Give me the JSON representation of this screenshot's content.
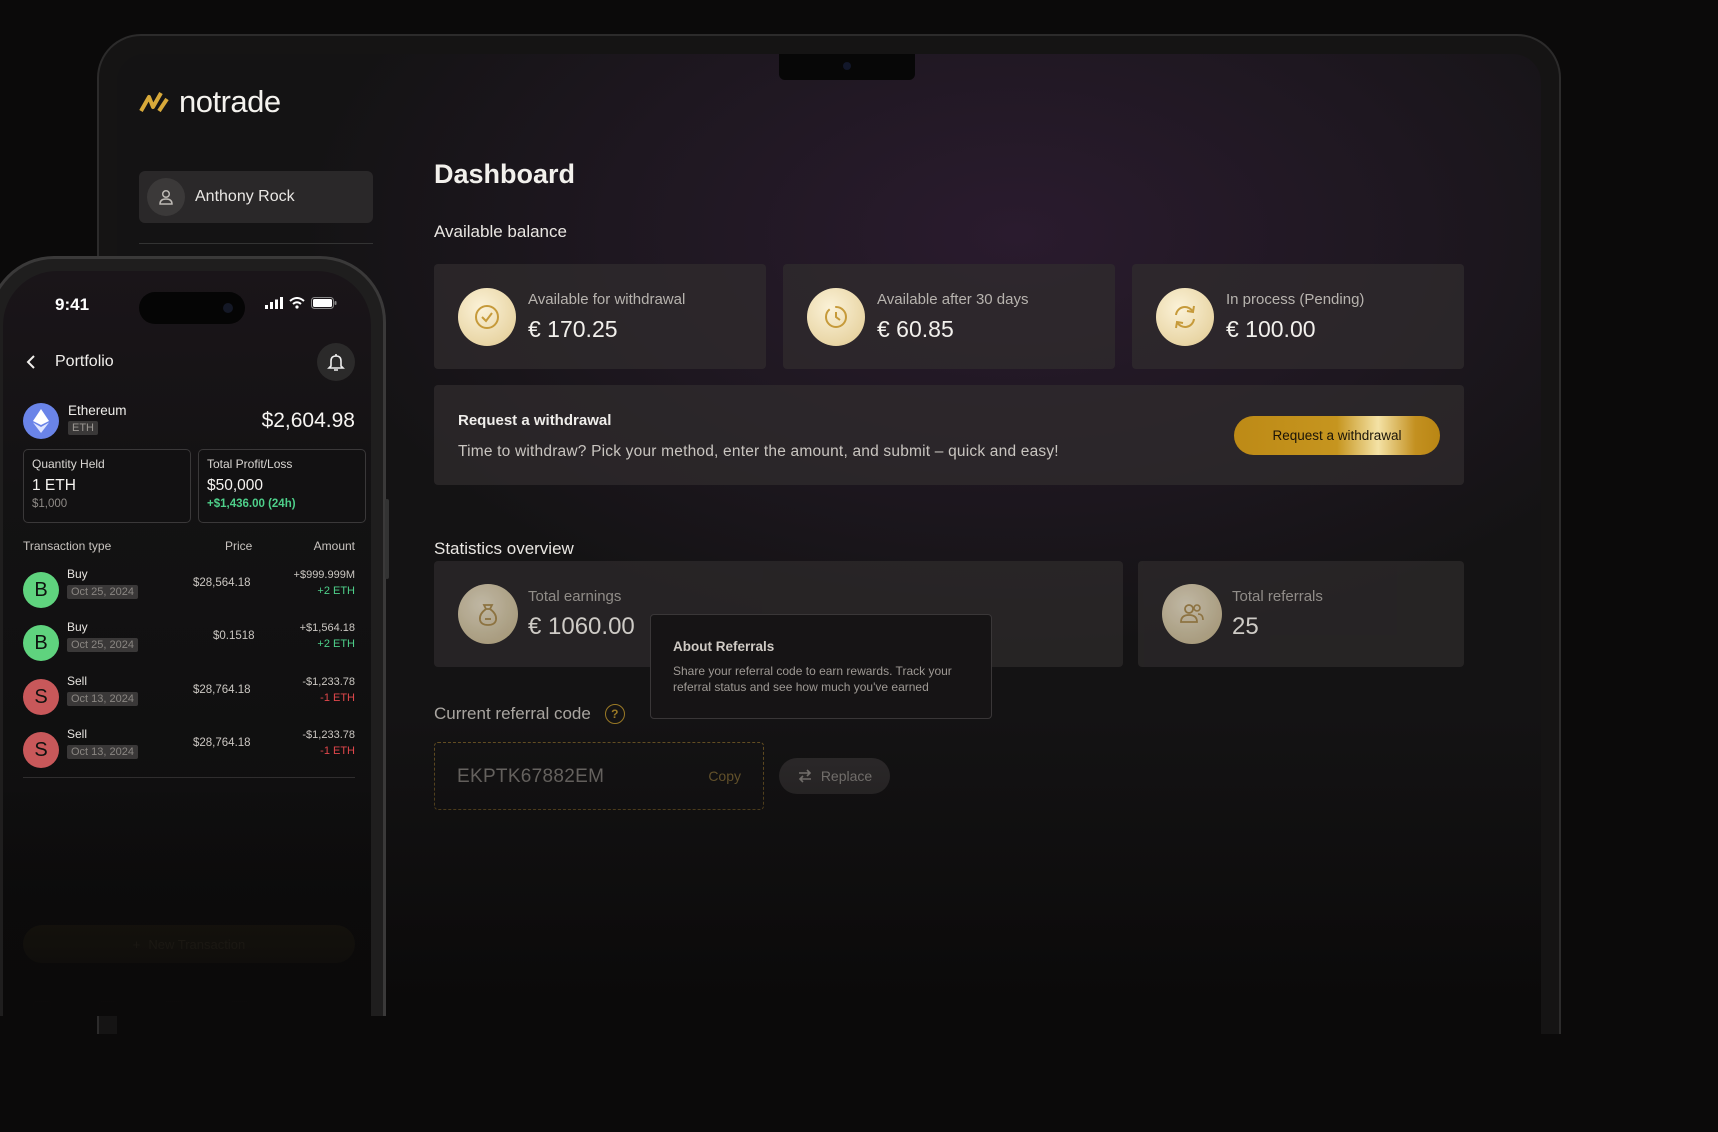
{
  "app": {
    "brand": "notrade"
  },
  "sidebar": {
    "user_name": "Anthony Rock"
  },
  "dashboard": {
    "title": "Dashboard",
    "available_balance_title": "Available balance",
    "balances": [
      {
        "label": "Available for withdrawal",
        "value": "€ 170.25",
        "icon": "check-circle-icon"
      },
      {
        "label": "Available after 30 days",
        "value": "€ 60.85",
        "icon": "clock-icon"
      },
      {
        "label": "In process (Pending)",
        "value": "€ 100.00",
        "icon": "refresh-icon"
      }
    ],
    "withdrawal": {
      "title": "Request a withdrawal",
      "description": "Time to withdraw? Pick your method, enter the amount, and submit – quick and easy!",
      "button_label": "Request a withdrawal"
    },
    "statistics_title": "Statistics overview",
    "stats": [
      {
        "label": "Total earnings",
        "value": "€ 1060.00",
        "icon": "money-bag-icon"
      },
      {
        "label": "Total referrals",
        "value": "25",
        "icon": "users-icon"
      }
    ],
    "tooltip": {
      "title": "About Referrals",
      "text": "Share your referral code to earn rewards. Track your referral status and see how much you've earned"
    },
    "referral": {
      "label": "Current referral code",
      "code": "EKPTK67882EM",
      "copy_label": "Copy",
      "replace_label": "Replace"
    }
  },
  "phone": {
    "time": "9:41",
    "title": "Portfolio",
    "asset": {
      "name": "Ethereum",
      "symbol": "ETH",
      "value": "$2,604.98"
    },
    "quantity": {
      "label": "Quantity Held",
      "value": "1 ETH",
      "sub": "$1,000"
    },
    "profit": {
      "label": "Total Profit/Loss",
      "value": "$50,000",
      "sub": "+$1,436.00 (24h)"
    },
    "table_headers": {
      "type": "Transaction type",
      "price": "Price",
      "amount": "Amount"
    },
    "transactions": [
      {
        "initial": "B",
        "type": "Buy",
        "date": "Oct 25, 2024",
        "price": "$28,564.18",
        "amount": "+$999.999M",
        "delta": "+2 ETH"
      },
      {
        "initial": "B",
        "type": "Buy",
        "date": "Oct 25, 2024",
        "price": "$0.1518",
        "amount": "+$1,564.18",
        "delta": "+2 ETH"
      },
      {
        "initial": "S",
        "type": "Sell",
        "date": "Oct 13, 2024",
        "price": "$28,764.18",
        "amount": "-$1,233.78",
        "delta": "-1 ETH"
      },
      {
        "initial": "S",
        "type": "Sell",
        "date": "Oct 13, 2024",
        "price": "$28,764.18",
        "amount": "-$1,233.78",
        "delta": "-1 ETH"
      }
    ],
    "new_transaction_label": "New Transaction"
  },
  "colors": {
    "gold": "#c6951f",
    "buy": "#5fd37e",
    "sell": "#c8585a",
    "profit_green": "#4ed08a",
    "loss_red": "#e0474b"
  }
}
